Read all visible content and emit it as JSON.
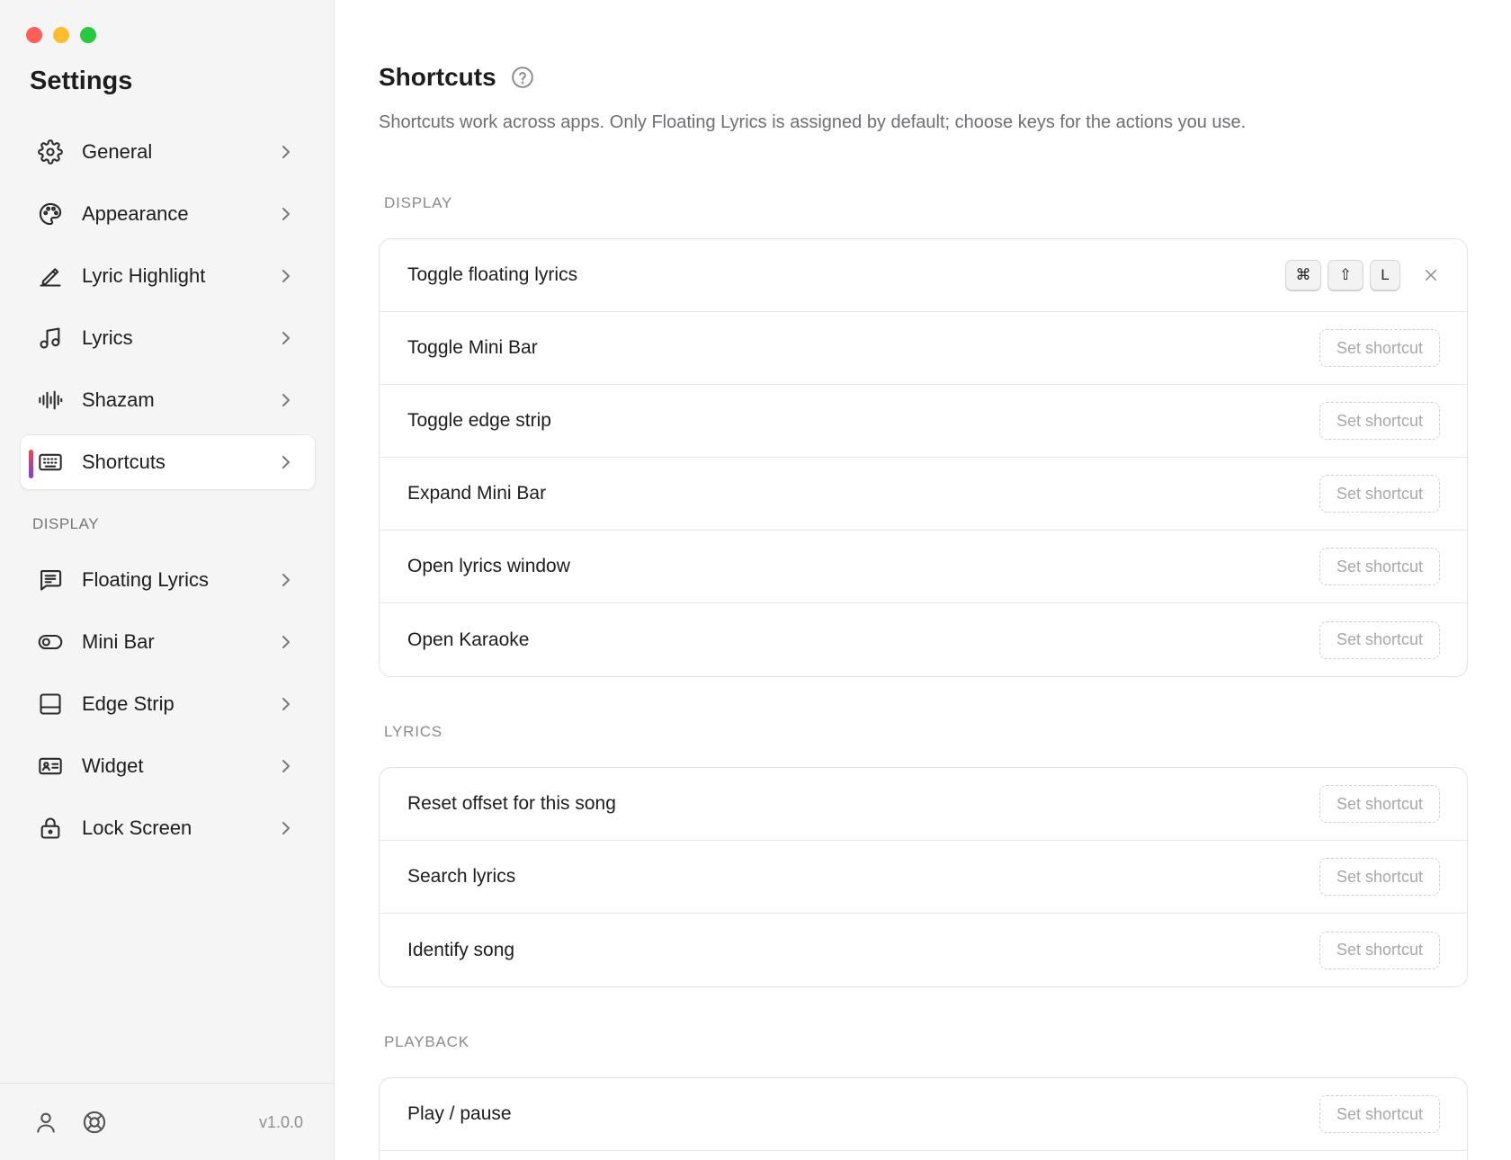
{
  "window": {
    "title": "Settings"
  },
  "sidebar": {
    "items": [
      {
        "label": "General",
        "icon": "gear-icon"
      },
      {
        "label": "Appearance",
        "icon": "palette-icon"
      },
      {
        "label": "Lyric Highlight",
        "icon": "pen-icon"
      },
      {
        "label": "Lyrics",
        "icon": "music-note-icon"
      },
      {
        "label": "Shazam",
        "icon": "waveform-icon"
      },
      {
        "label": "Shortcuts",
        "icon": "keyboard-icon",
        "active": true
      }
    ],
    "display_section": "DISPLAY",
    "display_items": [
      {
        "label": "Floating Lyrics",
        "icon": "message-icon"
      },
      {
        "label": "Mini Bar",
        "icon": "toggle-icon"
      },
      {
        "label": "Edge Strip",
        "icon": "edge-panel-icon"
      },
      {
        "label": "Widget",
        "icon": "id-card-icon"
      },
      {
        "label": "Lock Screen",
        "icon": "lock-icon"
      }
    ],
    "footer": {
      "version": "v1.0.0"
    }
  },
  "main": {
    "title": "Shortcuts",
    "description": "Shortcuts work across apps. Only Floating Lyrics is assigned by default; choose keys for the actions you use.",
    "set_label": "Set shortcut",
    "sections": {
      "display": {
        "label": "DISPLAY",
        "rows": [
          {
            "label": "Toggle floating lyrics",
            "keys": [
              "⌘",
              "⇧",
              "L"
            ]
          },
          {
            "label": "Toggle Mini Bar"
          },
          {
            "label": "Toggle edge strip"
          },
          {
            "label": "Expand Mini Bar"
          },
          {
            "label": "Open lyrics window"
          },
          {
            "label": "Open Karaoke"
          }
        ]
      },
      "lyrics": {
        "label": "LYRICS",
        "rows": [
          {
            "label": "Reset offset for this song"
          },
          {
            "label": "Search lyrics"
          },
          {
            "label": "Identify song"
          }
        ]
      },
      "playback": {
        "label": "PLAYBACK",
        "rows": [
          {
            "label": "Play / pause"
          }
        ]
      }
    }
  },
  "colors": {
    "close": "#ff5f57",
    "minimize": "#febc2e",
    "maximize": "#28c840",
    "active_accent_top": "#e84c4c",
    "active_accent_bottom": "#7b3fd6"
  }
}
